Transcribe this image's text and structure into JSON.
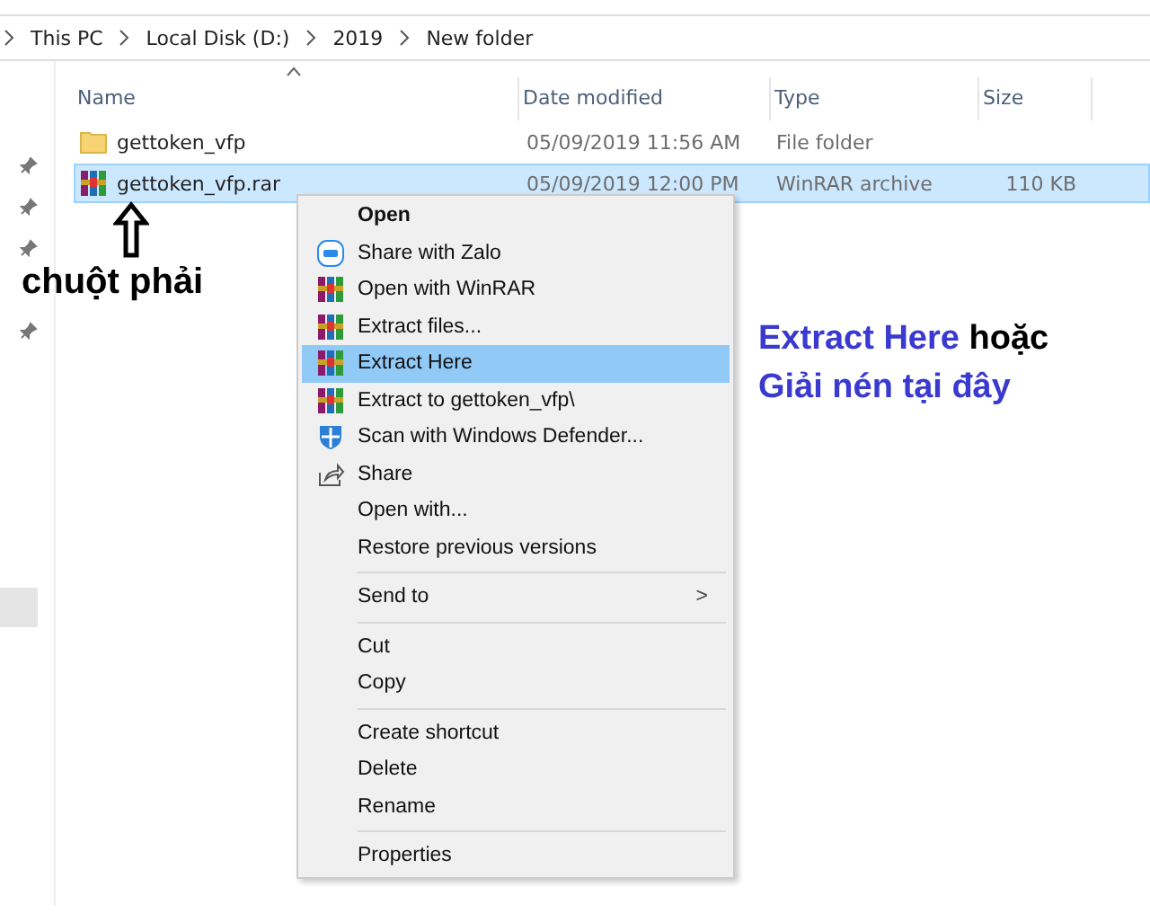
{
  "breadcrumb": [
    "This PC",
    "Local Disk (D:)",
    "2019",
    "New folder"
  ],
  "columns": [
    "Name",
    "Date modified",
    "Type",
    "Size"
  ],
  "files": [
    {
      "name": "gettoken_vfp",
      "date": "05/09/2019 11:56 AM",
      "type": "File folder",
      "kind": "folder",
      "selected": false
    },
    {
      "name": "gettoken_vfp.rar",
      "date": "05/09/2019 12:00 PM",
      "type": "WinRAR archive",
      "size": "110 KB",
      "kind": "archive",
      "selected": true
    }
  ],
  "pointer_label": "chuột phải",
  "annotation": {
    "highlight": "Extract Here",
    "connector": "hoặc",
    "second_line": "Giải nén tại đây"
  },
  "context_menu": [
    {
      "kind": "default",
      "label": "Open",
      "selected": false
    },
    {
      "kind": "item",
      "label": "Share with Zalo",
      "selected": false
    },
    {
      "kind": "item",
      "label": "Open with WinRAR",
      "selected": false
    },
    {
      "kind": "item",
      "label": "Extract files...",
      "selected": false
    },
    {
      "kind": "item",
      "label": "Extract Here",
      "selected": true
    },
    {
      "kind": "item",
      "label": "Extract to gettoken_vfp\\",
      "selected": false
    },
    {
      "kind": "item",
      "label": "Scan with Windows Defender...",
      "selected": false
    },
    {
      "kind": "item",
      "label": "Share",
      "selected": false
    },
    {
      "kind": "item",
      "label": "Open with...",
      "selected": false
    },
    {
      "kind": "item",
      "label": "Restore previous versions",
      "selected": false
    },
    {
      "kind": "separator"
    },
    {
      "kind": "submenu",
      "label": "Send to",
      "arrow": ">",
      "selected": false
    },
    {
      "kind": "separator"
    },
    {
      "kind": "item",
      "label": "Cut",
      "selected": false
    },
    {
      "kind": "item",
      "label": "Copy",
      "selected": false
    },
    {
      "kind": "separator"
    },
    {
      "kind": "item",
      "label": "Create shortcut",
      "selected": false
    },
    {
      "kind": "item",
      "label": "Delete",
      "selected": false
    },
    {
      "kind": "item",
      "label": "Rename",
      "selected": false
    },
    {
      "kind": "separator"
    },
    {
      "kind": "item",
      "label": "Properties",
      "selected": false
    }
  ]
}
